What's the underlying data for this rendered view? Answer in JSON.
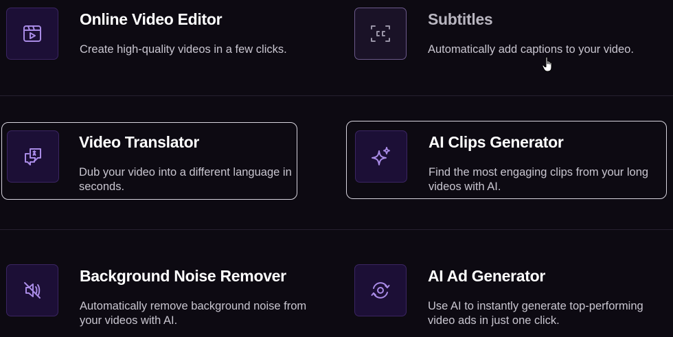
{
  "features": [
    {
      "title": "Online Video Editor",
      "description": "Create high-quality videos in a few clicks.",
      "icon": "video-clapper-icon"
    },
    {
      "title": "Subtitles",
      "description": "Automatically add captions to your video.",
      "icon": "closed-captions-icon"
    },
    {
      "title": "Video Translator",
      "description": "Dub your video into a different language in seconds.",
      "icon": "translate-chat-icon"
    },
    {
      "title": "AI Clips Generator",
      "description": "Find the most engaging clips from your long videos with AI.",
      "icon": "sparkles-icon"
    },
    {
      "title": "Background Noise Remover",
      "description": "Automatically remove background noise from your videos with AI.",
      "icon": "noise-off-icon"
    },
    {
      "title": "AI Ad Generator",
      "description": "Use AI to instantly generate top-performing video ads in just one click.",
      "icon": "ad-cycle-icon"
    }
  ],
  "colors": {
    "background": "#0d0a12",
    "icon_box": "#1c0f36",
    "icon_stroke": "#a98be6",
    "highlight_border": "#d9d6e0"
  }
}
